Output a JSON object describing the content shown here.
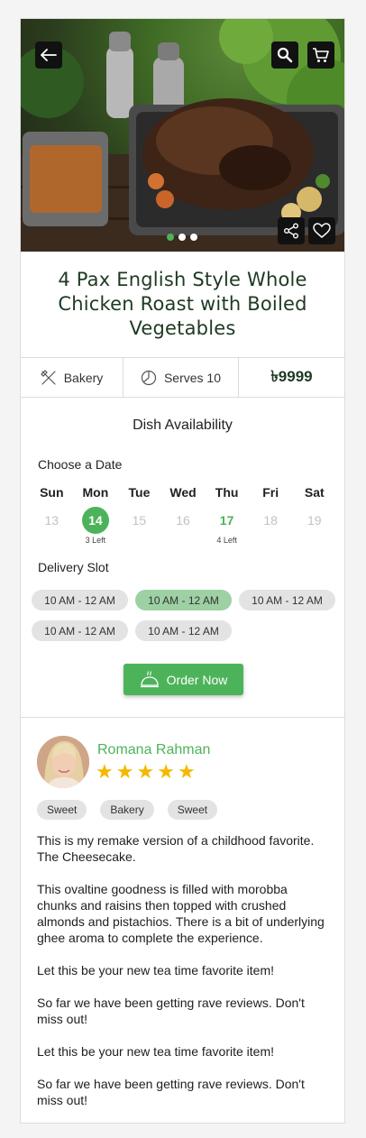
{
  "product": {
    "title": "4 Pax English Style Whole Chicken Roast with Boiled Vegetables",
    "category": "Bakery",
    "serves": "Serves 10",
    "price": "৳9999"
  },
  "gallery": {
    "slides": 3,
    "active_slide": 1
  },
  "availability": {
    "heading": "Dish Availability",
    "date_label": "Choose a Date",
    "days": [
      {
        "name": "Sun",
        "num": "13",
        "left": "",
        "state": "disabled"
      },
      {
        "name": "Mon",
        "num": "14",
        "left": "3 Left",
        "state": "selected"
      },
      {
        "name": "Tue",
        "num": "15",
        "left": "",
        "state": "disabled"
      },
      {
        "name": "Wed",
        "num": "16",
        "left": "",
        "state": "disabled"
      },
      {
        "name": "Thu",
        "num": "17",
        "left": "4 Left",
        "state": "available"
      },
      {
        "name": "Fri",
        "num": "18",
        "left": "",
        "state": "disabled"
      },
      {
        "name": "Sat",
        "num": "19",
        "left": "",
        "state": "disabled"
      }
    ],
    "slot_label": "Delivery Slot",
    "slots": [
      {
        "label": "10 AM - 12 AM",
        "selected": false
      },
      {
        "label": "10 AM - 12 AM",
        "selected": true
      },
      {
        "label": "10 AM - 12 AM",
        "selected": false
      },
      {
        "label": "10 AM - 12 AM",
        "selected": false
      },
      {
        "label": "10 AM - 12 AM",
        "selected": false
      }
    ],
    "order_label": "Order Now"
  },
  "review": {
    "name": "Romana Rahman",
    "rating": 5,
    "tags": [
      "Sweet",
      "Bakery",
      "Sweet"
    ],
    "paragraphs": [
      "This is my remake version of a childhood favorite. The Cheesecake.",
      "This ovaltine goodness is filled with morobba chunks and raisins then topped with crushed almonds and pistachios. There is a bit of underlying ghee aroma to complete the experience.",
      "Let this be your new tea time favorite item!",
      "So far we have been getting rave reviews. Don't miss out!",
      "Let this be your new tea time favorite item!",
      "So far we have been getting rave reviews. Don't miss out!"
    ]
  },
  "icons": {
    "back": "arrow-left-icon",
    "search": "search-icon",
    "cart": "cart-icon",
    "share": "share-icon",
    "favorite": "heart-icon",
    "category": "utensils-icon",
    "serves": "pie-chart-icon",
    "order": "cloche-icon"
  },
  "colors": {
    "accent": "#4db35a",
    "accent_light": "#9dd1a3",
    "star": "#f5b800",
    "title": "#1e3a22"
  }
}
